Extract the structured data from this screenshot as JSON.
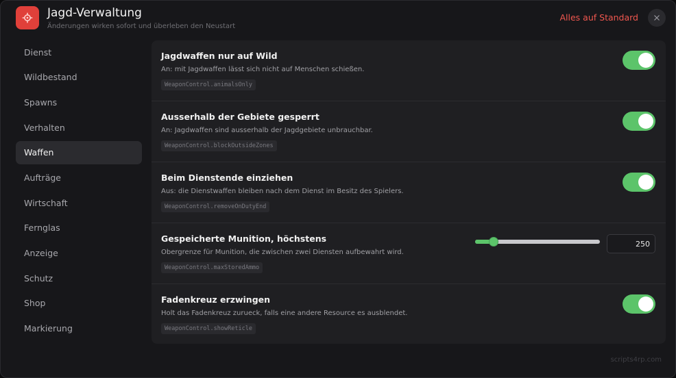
{
  "header": {
    "title": "Jagd-Verwaltung",
    "subtitle": "Änderungen wirken sofort und überleben den Neustart",
    "reset_label": "Alles auf Standard",
    "app_icon": "gear-icon",
    "close_icon": "close-icon",
    "accent_color": "#e0403a"
  },
  "sidebar": {
    "items": [
      {
        "label": "Dienst",
        "active": false
      },
      {
        "label": "Wildbestand",
        "active": false
      },
      {
        "label": "Spawns",
        "active": false
      },
      {
        "label": "Verhalten",
        "active": false
      },
      {
        "label": "Waffen",
        "active": true
      },
      {
        "label": "Aufträge",
        "active": false
      },
      {
        "label": "Wirtschaft",
        "active": false
      },
      {
        "label": "Fernglas",
        "active": false
      },
      {
        "label": "Anzeige",
        "active": false
      },
      {
        "label": "Schutz",
        "active": false
      },
      {
        "label": "Shop",
        "active": false
      },
      {
        "label": "Markierung",
        "active": false
      }
    ]
  },
  "settings": [
    {
      "title": "Jagdwaffen nur auf Wild",
      "description": "An: mit Jagdwaffen lässt sich nicht auf Menschen schießen.",
      "key": "WeaponControl.animalsOnly",
      "control": "toggle",
      "enabled": true
    },
    {
      "title": "Ausserhalb der Gebiete gesperrt",
      "description": "An: Jagdwaffen sind ausserhalb der Jagdgebiete unbrauchbar.",
      "key": "WeaponControl.blockOutsideZones",
      "control": "toggle",
      "enabled": true
    },
    {
      "title": "Beim Dienstende einziehen",
      "description": "Aus: die Dienstwaffen bleiben nach dem Dienst im Besitz des Spielers.",
      "key": "WeaponControl.removeOnDutyEnd",
      "control": "toggle",
      "enabled": true
    },
    {
      "title": "Gespeicherte Munition, höchstens",
      "description": "Obergrenze für Munition, die zwischen zwei Diensten aufbewahrt wird.",
      "key": "WeaponControl.maxStoredAmmo",
      "control": "slider",
      "value": "250",
      "slider_fraction": 0.15
    },
    {
      "title": "Fadenkreuz erzwingen",
      "description": "Holt das Fadenkreuz zurueck, falls eine andere Resource es ausblendet.",
      "key": "WeaponControl.showReticle",
      "control": "toggle",
      "enabled": true
    }
  ],
  "footer": {
    "text": "scripts4rp.com"
  },
  "colors": {
    "toggle_on": "#5cc46a",
    "reset_link": "#f0574f"
  }
}
